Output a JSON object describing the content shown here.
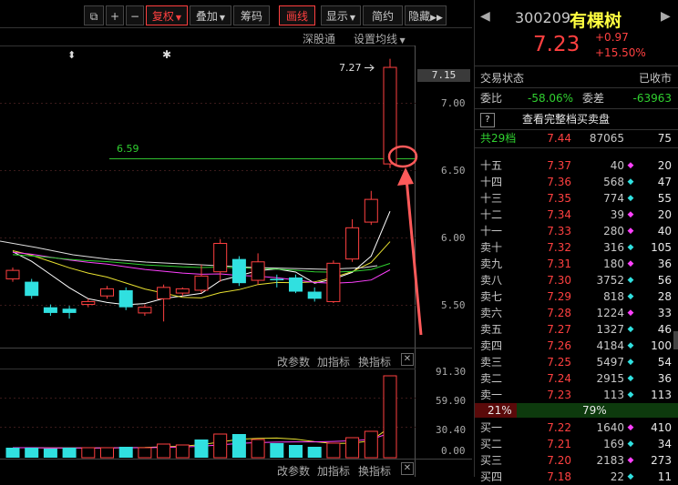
{
  "toolbar": {
    "restore_label": "复权",
    "overlay_label": "叠加",
    "chips_label": "筹码",
    "draw_label": "画线",
    "display_label": "显示",
    "simple_label": "简约",
    "hide_label": "隐藏"
  },
  "subtoolbar": {
    "deep_label": "深股通",
    "ma_settings_label": "设置均线"
  },
  "price_annotations": {
    "high": "7.27",
    "line_value": "6.59"
  },
  "price_axis": [
    "7.15",
    "7.00",
    "6.50",
    "6.00",
    "5.50"
  ],
  "indicator_toolbar": {
    "params_label": "改参数",
    "add_label": "加指标",
    "switch_label": "换指标"
  },
  "volume_axis": [
    "91.30",
    "59.90",
    "30.40",
    "0.00"
  ],
  "colors": {
    "up": "#ff4040",
    "down": "#30e0e0",
    "ma5": "#ffffff",
    "ma10": "#e8e030",
    "ma20": "#ff40ff",
    "ma60": "#30d030",
    "annotation_arrow": "#ff5a5a"
  },
  "chart_data": {
    "type": "candlestick",
    "ylim": [
      5.3,
      7.3
    ],
    "candles": [
      {
        "o": 5.72,
        "c": 5.78,
        "h": 5.8,
        "l": 5.7
      },
      {
        "o": 5.7,
        "c": 5.6,
        "h": 5.72,
        "l": 5.58
      },
      {
        "o": 5.52,
        "c": 5.48,
        "h": 5.54,
        "l": 5.46
      },
      {
        "o": 5.51,
        "c": 5.48,
        "h": 5.53,
        "l": 5.44
      },
      {
        "o": 5.54,
        "c": 5.56,
        "h": 5.58,
        "l": 5.52
      },
      {
        "o": 5.6,
        "c": 5.65,
        "h": 5.67,
        "l": 5.58
      },
      {
        "o": 5.64,
        "c": 5.52,
        "h": 5.66,
        "l": 5.5
      },
      {
        "o": 5.48,
        "c": 5.52,
        "h": 5.54,
        "l": 5.46
      },
      {
        "o": 5.58,
        "c": 5.66,
        "h": 5.68,
        "l": 5.42
      },
      {
        "o": 5.62,
        "c": 5.65,
        "h": 5.66,
        "l": 5.6
      },
      {
        "o": 5.64,
        "c": 5.74,
        "h": 5.82,
        "l": 5.62
      },
      {
        "o": 5.77,
        "c": 5.97,
        "h": 6.0,
        "l": 5.7
      },
      {
        "o": 5.86,
        "c": 5.69,
        "h": 5.88,
        "l": 5.67
      },
      {
        "o": 5.71,
        "c": 5.84,
        "h": 5.9,
        "l": 5.68
      },
      {
        "o": 5.72,
        "c": 5.71,
        "h": 5.75,
        "l": 5.66
      },
      {
        "o": 5.73,
        "c": 5.63,
        "h": 5.75,
        "l": 5.62
      },
      {
        "o": 5.63,
        "c": 5.58,
        "h": 5.66,
        "l": 5.56
      },
      {
        "o": 5.56,
        "c": 5.83,
        "h": 5.85,
        "l": 5.55
      },
      {
        "o": 5.86,
        "c": 6.08,
        "h": 6.14,
        "l": 5.84
      },
      {
        "o": 6.12,
        "c": 6.28,
        "h": 6.34,
        "l": 6.1
      },
      {
        "o": 6.53,
        "c": 7.21,
        "h": 7.27,
        "l": 6.5
      }
    ],
    "volume": [
      {
        "v": 11,
        "up": false
      },
      {
        "v": 11,
        "up": false
      },
      {
        "v": 10,
        "up": false
      },
      {
        "v": 11,
        "up": false
      },
      {
        "v": 11,
        "up": true
      },
      {
        "v": 11,
        "up": true
      },
      {
        "v": 12,
        "up": false
      },
      {
        "v": 11,
        "up": true
      },
      {
        "v": 15,
        "up": true
      },
      {
        "v": 14,
        "up": true
      },
      {
        "v": 20,
        "up": false
      },
      {
        "v": 26,
        "up": true
      },
      {
        "v": 26,
        "up": false
      },
      {
        "v": 20,
        "up": true
      },
      {
        "v": 16,
        "up": false
      },
      {
        "v": 14,
        "up": false
      },
      {
        "v": 12,
        "up": false
      },
      {
        "v": 16,
        "up": true
      },
      {
        "v": 22,
        "up": true
      },
      {
        "v": 29,
        "up": true
      },
      {
        "v": 90,
        "up": true
      }
    ],
    "vol_ylim": [
      0,
      95
    ]
  },
  "quote": {
    "code": "300209",
    "name": "有棵树",
    "price": "7.23",
    "change": "+0.97",
    "change_pct": "+15.50%",
    "status_label": "交易状态",
    "status_value": "已收市",
    "ratio_label": "委比",
    "ratio_value": "-58.06%",
    "diff_label": "委差",
    "diff_value": "-63963",
    "full_book_label": "查看完整档买卖盘",
    "total_levels_label": "共29档",
    "total_price": "7.44",
    "total_vol": "87065",
    "total_count": "75",
    "sell_pct": "21%",
    "buy_pct": "79%"
  },
  "orderbook_asks": [
    {
      "label": "十五",
      "price": "7.37",
      "vol": "40",
      "mark": "◆",
      "mark_color": "magenta",
      "count": "20"
    },
    {
      "label": "十四",
      "price": "7.36",
      "vol": "568",
      "mark": "◆",
      "mark_color": "cyan",
      "count": "47"
    },
    {
      "label": "十三",
      "price": "7.35",
      "vol": "774",
      "mark": "◆",
      "mark_color": "cyan",
      "count": "55"
    },
    {
      "label": "十二",
      "price": "7.34",
      "vol": "39",
      "mark": "◆",
      "mark_color": "magenta",
      "count": "20"
    },
    {
      "label": "十一",
      "price": "7.33",
      "vol": "280",
      "mark": "◆",
      "mark_color": "magenta",
      "count": "40"
    },
    {
      "label": "卖十",
      "price": "7.32",
      "vol": "316",
      "mark": "◆",
      "mark_color": "cyan",
      "count": "105"
    },
    {
      "label": "卖九",
      "price": "7.31",
      "vol": "180",
      "mark": "◆",
      "mark_color": "magenta",
      "count": "36"
    },
    {
      "label": "卖八",
      "price": "7.30",
      "vol": "3752",
      "mark": "◆",
      "mark_color": "cyan",
      "count": "56"
    },
    {
      "label": "卖七",
      "price": "7.29",
      "vol": "818",
      "mark": "◆",
      "mark_color": "cyan",
      "count": "28"
    },
    {
      "label": "卖六",
      "price": "7.28",
      "vol": "1224",
      "mark": "◆",
      "mark_color": "magenta",
      "count": "33"
    },
    {
      "label": "卖五",
      "price": "7.27",
      "vol": "1327",
      "mark": "◆",
      "mark_color": "cyan",
      "count": "46"
    },
    {
      "label": "卖四",
      "price": "7.26",
      "vol": "4184",
      "mark": "◆",
      "mark_color": "cyan",
      "count": "100"
    },
    {
      "label": "卖三",
      "price": "7.25",
      "vol": "5497",
      "mark": "◆",
      "mark_color": "cyan",
      "count": "54"
    },
    {
      "label": "卖二",
      "price": "7.24",
      "vol": "2915",
      "mark": "◆",
      "mark_color": "cyan",
      "count": "36"
    },
    {
      "label": "卖一",
      "price": "7.23",
      "vol": "113",
      "mark": "◆",
      "mark_color": "cyan",
      "count": "113"
    }
  ],
  "orderbook_bids": [
    {
      "label": "买一",
      "price": "7.22",
      "vol": "1640",
      "mark": "◆",
      "mark_color": "magenta",
      "count": "410"
    },
    {
      "label": "买二",
      "price": "7.21",
      "vol": "169",
      "mark": "◆",
      "mark_color": "cyan",
      "count": "34"
    },
    {
      "label": "买三",
      "price": "7.20",
      "vol": "2183",
      "mark": "◆",
      "mark_color": "magenta",
      "count": "273"
    },
    {
      "label": "买四",
      "price": "7.18",
      "vol": "22",
      "mark": "◆",
      "mark_color": "cyan",
      "count": "11"
    }
  ]
}
